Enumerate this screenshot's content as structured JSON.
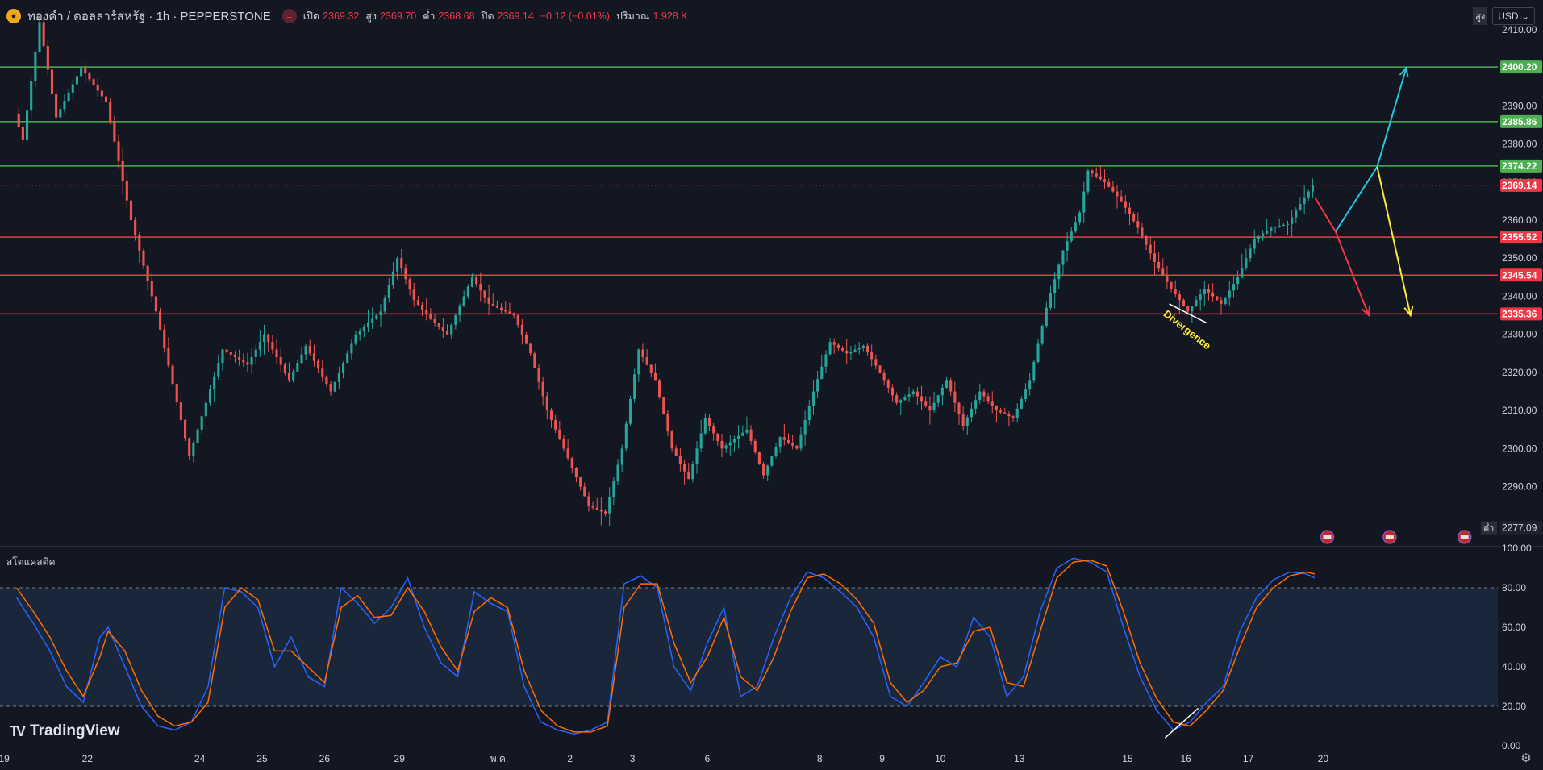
{
  "header": {
    "symbol": "ทองคำ / ดอลลาร์สหรัฐ · 1h · PEPPERSTONE",
    "logo_icon": "gold-coin-icon",
    "open_label": "เปิด",
    "open": "2369.32",
    "high_label": "สูง",
    "high": "2369.70",
    "low_label": "ต่ำ",
    "low": "2368.68",
    "close_label": "ปิด",
    "close": "2369.14",
    "change": "−0.12 (−0.01%)",
    "volume_label": "ปริมาณ",
    "volume": "1.928 K"
  },
  "toolbar": {
    "high_marker": "สูง",
    "currency": "USD"
  },
  "indicator": {
    "name": "สโตแคสติค"
  },
  "branding": {
    "name": "TradingView"
  },
  "colors": {
    "background": "#131722",
    "up": "#26a69a",
    "down": "#ef5350",
    "resistance": "#4caf50",
    "support": "#f23645",
    "current": "#f23645",
    "stoch_k": "#2962ff",
    "stoch_d": "#ff6d00",
    "band": "#1c2a40",
    "arrow_up": "#26c6da",
    "arrow_mid": "#ffeb3b",
    "arrow_down": "#f23645"
  },
  "chart_data": {
    "type": "candlestick",
    "symbol": "XAUUSD",
    "interval": "1h",
    "ylim": [
      2277,
      2414
    ],
    "y_ticks": [
      2410,
      2400,
      2390,
      2380,
      2370,
      2360,
      2350,
      2340,
      2330,
      2320,
      2310,
      2300,
      2290,
      2280
    ],
    "x_ticks": [
      "19",
      "22",
      "24",
      "25",
      "26",
      "29",
      "พ.ค.",
      "2",
      "3",
      "6",
      "8",
      "9",
      "10",
      "13",
      "15",
      "16",
      "17",
      "20"
    ],
    "horizontal_levels": [
      {
        "value": 2400.2,
        "label": "2400.20",
        "kind": "resistance"
      },
      {
        "value": 2385.86,
        "label": "2385.86",
        "kind": "resistance"
      },
      {
        "value": 2374.22,
        "label": "2374.22",
        "kind": "resistance"
      },
      {
        "value": 2355.52,
        "label": "2355.52",
        "kind": "support"
      },
      {
        "value": 2345.54,
        "label": "2345.54",
        "kind": "support"
      },
      {
        "value": 2335.36,
        "label": "2335.36",
        "kind": "support"
      }
    ],
    "current_price": {
      "value": 2369.14,
      "label": "2369.14"
    },
    "low_marker": {
      "value": 2277.09,
      "label": "2277.09",
      "caption": "ต่ำ"
    },
    "annotation": {
      "text": "Divergence"
    },
    "price_path": [
      [
        0,
        2388
      ],
      [
        1,
        2381
      ],
      [
        3,
        2412
      ],
      [
        5,
        2387
      ],
      [
        8,
        2400
      ],
      [
        11,
        2391
      ],
      [
        14,
        2360
      ],
      [
        17,
        2336
      ],
      [
        21,
        2298
      ],
      [
        23,
        2312
      ],
      [
        25,
        2326
      ],
      [
        28,
        2322
      ],
      [
        30,
        2330
      ],
      [
        33,
        2318
      ],
      [
        35,
        2327
      ],
      [
        38,
        2315
      ],
      [
        41,
        2330
      ],
      [
        44,
        2336
      ],
      [
        46,
        2350
      ],
      [
        48,
        2339
      ],
      [
        50,
        2334
      ],
      [
        52,
        2330
      ],
      [
        55,
        2345
      ],
      [
        57,
        2338
      ],
      [
        60,
        2335
      ],
      [
        62,
        2325
      ],
      [
        64,
        2310
      ],
      [
        66,
        2300
      ],
      [
        69,
        2285
      ],
      [
        71,
        2283
      ],
      [
        73,
        2300
      ],
      [
        75,
        2326
      ],
      [
        77,
        2318
      ],
      [
        79,
        2300
      ],
      [
        81,
        2292
      ],
      [
        83,
        2308
      ],
      [
        85,
        2300
      ],
      [
        88,
        2305
      ],
      [
        90,
        2293
      ],
      [
        92,
        2303
      ],
      [
        94,
        2300
      ],
      [
        96,
        2315
      ],
      [
        98,
        2328
      ],
      [
        100,
        2325
      ],
      [
        102,
        2327
      ],
      [
        104,
        2320
      ],
      [
        106,
        2312
      ],
      [
        108,
        2315
      ],
      [
        110,
        2310
      ],
      [
        112,
        2318
      ],
      [
        114,
        2306
      ],
      [
        116,
        2315
      ],
      [
        118,
        2310
      ],
      [
        120,
        2308
      ],
      [
        122,
        2318
      ],
      [
        124,
        2337
      ],
      [
        126,
        2352
      ],
      [
        128,
        2362
      ],
      [
        129,
        2373
      ],
      [
        131,
        2370
      ],
      [
        133,
        2365
      ],
      [
        135,
        2358
      ],
      [
        137,
        2349
      ],
      [
        139,
        2342
      ],
      [
        141,
        2336
      ],
      [
        143,
        2342
      ],
      [
        145,
        2338
      ],
      [
        147,
        2345
      ],
      [
        149,
        2355
      ],
      [
        151,
        2358
      ],
      [
        153,
        2359
      ],
      [
        155,
        2366
      ],
      [
        156,
        2369
      ]
    ],
    "projections": [
      {
        "from": [
          156,
          2366
        ],
        "to": [
          158.5,
          2357
        ],
        "color": "arrow_down"
      },
      {
        "from": [
          158.5,
          2357
        ],
        "to": [
          162.5,
          2335
        ],
        "color": "arrow_down",
        "arrowhead": true
      },
      {
        "from": [
          158.5,
          2357
        ],
        "to": [
          163.5,
          2374
        ],
        "color": "arrow_up"
      },
      {
        "from": [
          163.5,
          2374
        ],
        "to": [
          167,
          2400
        ],
        "color": "arrow_up",
        "arrowhead": true
      },
      {
        "from": [
          163.5,
          2374
        ],
        "to": [
          167.5,
          2335
        ],
        "color": "arrow_mid",
        "arrowhead": true
      }
    ],
    "stochastic": {
      "ylim": [
        0,
        100
      ],
      "y_ticks": [
        100,
        80,
        60,
        40,
        20,
        0
      ],
      "band": [
        20,
        80
      ],
      "k_path": [
        [
          0,
          75
        ],
        [
          2,
          62
        ],
        [
          4,
          48
        ],
        [
          6,
          30
        ],
        [
          8,
          22
        ],
        [
          10,
          55
        ],
        [
          11,
          60
        ],
        [
          13,
          40
        ],
        [
          15,
          20
        ],
        [
          17,
          10
        ],
        [
          19,
          8
        ],
        [
          21,
          12
        ],
        [
          23,
          30
        ],
        [
          25,
          80
        ],
        [
          27,
          78
        ],
        [
          29,
          70
        ],
        [
          31,
          40
        ],
        [
          33,
          55
        ],
        [
          35,
          35
        ],
        [
          37,
          30
        ],
        [
          39,
          80
        ],
        [
          41,
          72
        ],
        [
          43,
          62
        ],
        [
          45,
          70
        ],
        [
          47,
          85
        ],
        [
          49,
          60
        ],
        [
          51,
          42
        ],
        [
          53,
          35
        ],
        [
          55,
          78
        ],
        [
          57,
          72
        ],
        [
          59,
          68
        ],
        [
          61,
          30
        ],
        [
          63,
          12
        ],
        [
          65,
          8
        ],
        [
          67,
          6
        ],
        [
          69,
          8
        ],
        [
          71,
          12
        ],
        [
          73,
          82
        ],
        [
          75,
          86
        ],
        [
          77,
          80
        ],
        [
          79,
          40
        ],
        [
          81,
          28
        ],
        [
          83,
          52
        ],
        [
          85,
          70
        ],
        [
          87,
          25
        ],
        [
          89,
          30
        ],
        [
          91,
          55
        ],
        [
          93,
          75
        ],
        [
          95,
          88
        ],
        [
          97,
          85
        ],
        [
          99,
          78
        ],
        [
          101,
          70
        ],
        [
          103,
          55
        ],
        [
          105,
          25
        ],
        [
          107,
          20
        ],
        [
          109,
          32
        ],
        [
          111,
          45
        ],
        [
          113,
          40
        ],
        [
          115,
          65
        ],
        [
          117,
          55
        ],
        [
          119,
          25
        ],
        [
          121,
          35
        ],
        [
          123,
          68
        ],
        [
          125,
          90
        ],
        [
          127,
          95
        ],
        [
          129,
          93
        ],
        [
          131,
          88
        ],
        [
          133,
          60
        ],
        [
          135,
          35
        ],
        [
          137,
          18
        ],
        [
          139,
          8
        ],
        [
          141,
          12
        ],
        [
          143,
          22
        ],
        [
          145,
          30
        ],
        [
          147,
          58
        ],
        [
          149,
          75
        ],
        [
          151,
          84
        ],
        [
          153,
          88
        ],
        [
          155,
          87
        ],
        [
          156,
          85
        ]
      ],
      "d_path": [
        [
          0,
          80
        ],
        [
          2,
          68
        ],
        [
          4,
          55
        ],
        [
          6,
          38
        ],
        [
          8,
          25
        ],
        [
          10,
          45
        ],
        [
          11,
          58
        ],
        [
          13,
          48
        ],
        [
          15,
          28
        ],
        [
          17,
          15
        ],
        [
          19,
          10
        ],
        [
          21,
          12
        ],
        [
          23,
          22
        ],
        [
          25,
          70
        ],
        [
          27,
          80
        ],
        [
          29,
          74
        ],
        [
          31,
          48
        ],
        [
          33,
          48
        ],
        [
          35,
          40
        ],
        [
          37,
          32
        ],
        [
          39,
          70
        ],
        [
          41,
          76
        ],
        [
          43,
          65
        ],
        [
          45,
          66
        ],
        [
          47,
          80
        ],
        [
          49,
          68
        ],
        [
          51,
          50
        ],
        [
          53,
          38
        ],
        [
          55,
          68
        ],
        [
          57,
          75
        ],
        [
          59,
          70
        ],
        [
          61,
          38
        ],
        [
          63,
          18
        ],
        [
          65,
          10
        ],
        [
          67,
          7
        ],
        [
          69,
          7
        ],
        [
          71,
          10
        ],
        [
          73,
          70
        ],
        [
          75,
          82
        ],
        [
          77,
          82
        ],
        [
          79,
          52
        ],
        [
          81,
          32
        ],
        [
          83,
          45
        ],
        [
          85,
          65
        ],
        [
          87,
          35
        ],
        [
          89,
          28
        ],
        [
          91,
          45
        ],
        [
          93,
          68
        ],
        [
          95,
          85
        ],
        [
          97,
          87
        ],
        [
          99,
          82
        ],
        [
          101,
          74
        ],
        [
          103,
          62
        ],
        [
          105,
          32
        ],
        [
          107,
          22
        ],
        [
          109,
          28
        ],
        [
          111,
          40
        ],
        [
          113,
          42
        ],
        [
          115,
          58
        ],
        [
          117,
          60
        ],
        [
          119,
          32
        ],
        [
          121,
          30
        ],
        [
          123,
          58
        ],
        [
          125,
          85
        ],
        [
          127,
          93
        ],
        [
          129,
          94
        ],
        [
          131,
          91
        ],
        [
          133,
          68
        ],
        [
          135,
          42
        ],
        [
          137,
          24
        ],
        [
          139,
          12
        ],
        [
          141,
          10
        ],
        [
          143,
          18
        ],
        [
          145,
          28
        ],
        [
          147,
          50
        ],
        [
          149,
          70
        ],
        [
          151,
          80
        ],
        [
          153,
          86
        ],
        [
          155,
          88
        ],
        [
          156,
          87
        ]
      ]
    }
  }
}
